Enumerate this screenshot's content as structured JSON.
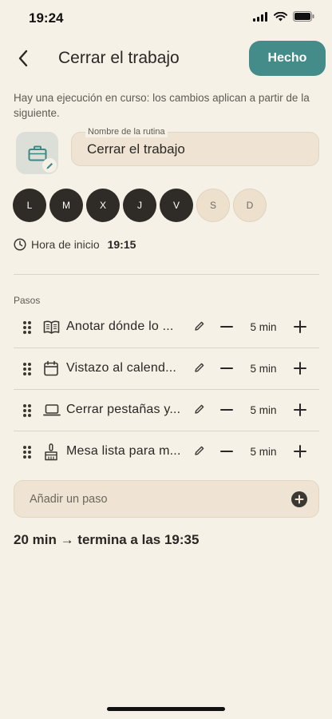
{
  "status_bar": {
    "time": "19:24"
  },
  "header": {
    "title": "Cerrar el trabajo",
    "done_label": "Hecho"
  },
  "notice": "Hay una ejecución en curso: los cambios aplican a partir de la siguiente.",
  "routine": {
    "icon": "briefcase-icon",
    "name_label": "Nombre de la rutina",
    "name_value": "Cerrar el trabajo"
  },
  "days": [
    {
      "label": "L",
      "active": true
    },
    {
      "label": "M",
      "active": true
    },
    {
      "label": "X",
      "active": true
    },
    {
      "label": "J",
      "active": true
    },
    {
      "label": "V",
      "active": true
    },
    {
      "label": "S",
      "active": false
    },
    {
      "label": "D",
      "active": false
    }
  ],
  "start": {
    "label": "Hora de inicio",
    "value": "19:15"
  },
  "steps_heading": "Pasos",
  "steps": [
    {
      "icon": "book-icon",
      "name": "Anotar dónde lo dejé",
      "display_name": "Anotar dónde lo ...",
      "duration": "5 min"
    },
    {
      "icon": "calendar-icon",
      "name": "Vistazo al calendario",
      "display_name": "Vistazo al calend...",
      "duration": "5 min"
    },
    {
      "icon": "laptop-icon",
      "name": "Cerrar pestañas y apps",
      "display_name": "Cerrar pestañas y...",
      "duration": "5 min"
    },
    {
      "icon": "broom-icon",
      "name": "Mesa lista para mañana",
      "display_name": "Mesa lista para m...",
      "duration": "5 min"
    }
  ],
  "add_step": {
    "label": "Añadir un paso"
  },
  "summary": "20 min → termina a las 19:35",
  "colors": {
    "background": "#f6f1e7",
    "accent": "#438c8a",
    "day_active": "#2f2c28",
    "day_inactive": "#ede1cd",
    "field": "#efe4d3"
  }
}
